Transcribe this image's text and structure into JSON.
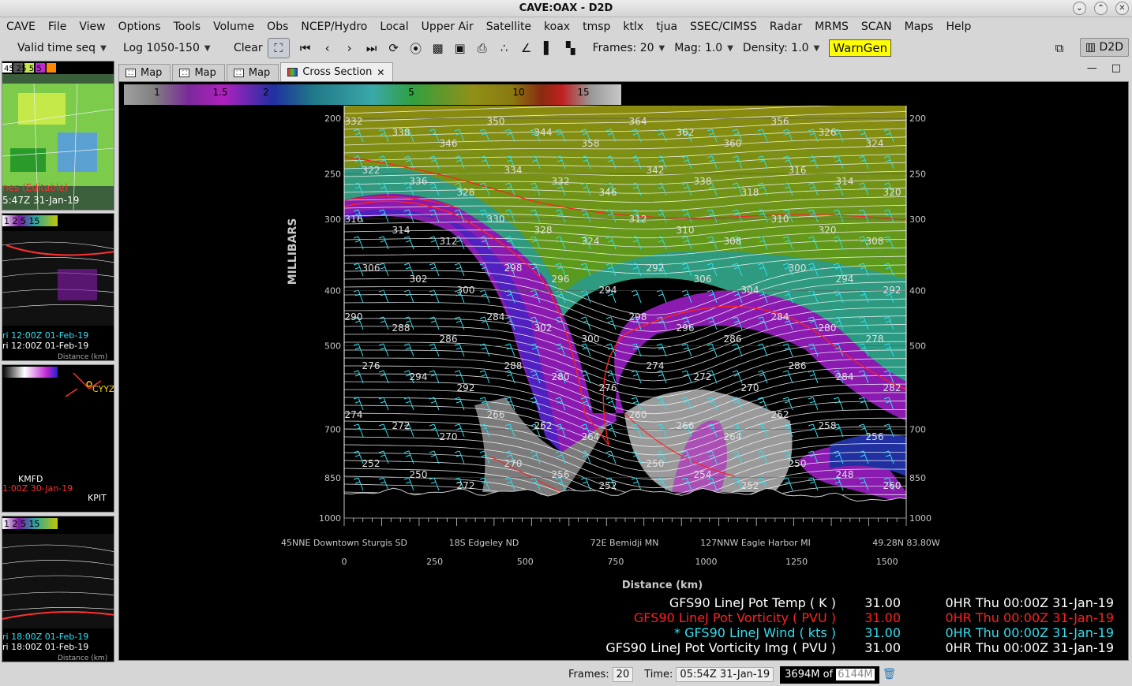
{
  "window": {
    "title": "CAVE:OAX - D2D",
    "buttons": [
      "⌄",
      "⌃",
      "✕"
    ]
  },
  "menu": [
    "CAVE",
    "File",
    "View",
    "Options",
    "Tools",
    "Volume",
    "Obs",
    "NCEP/Hydro",
    "Local",
    "Upper Air",
    "Satellite",
    "koax",
    "tmsp",
    "ktlx",
    "tjua",
    "SSEC/CIMSS",
    "Radar",
    "MRMS",
    "SCAN",
    "Maps",
    "Help"
  ],
  "toolbar": {
    "time_seq": "Valid time seq",
    "log": "Log 1050-150",
    "clear": "Clear",
    "frames": "Frames: 20",
    "mag": "Mag: 1.0",
    "density": "Density: 1.0",
    "warngen": "WarnGen",
    "d2d": "D2D"
  },
  "tabs": [
    {
      "label": "Map",
      "active": false
    },
    {
      "label": "Map",
      "active": false
    },
    {
      "label": "Map",
      "active": false
    },
    {
      "label": "Cross Section",
      "active": true
    }
  ],
  "side_panes": [
    {
      "top_text": "45 25 5 5",
      "label1": "nes (Editable)",
      "label2": "5:47Z 31-Jan-19"
    },
    {
      "scale": "1 2 5 15",
      "label1": "ri 12:00Z 01-Feb-19",
      "label2": "ri 12:00Z 01-Feb-19",
      "label3": "Distance (km)"
    },
    {
      "station": "CYYZ",
      "label1": "1:00Z 30-Jan-19",
      "label2": "KMFD",
      "label3": "KPIT"
    },
    {
      "scale": "1 2 5 15",
      "label1": "ri 18:00Z 01-Feb-19",
      "label2": "ri 18:00Z 01-Feb-19",
      "label3": "Distance (km)"
    }
  ],
  "colorbar": {
    "ticks": [
      "1",
      "1.5",
      "2",
      "5",
      "10",
      "15"
    ]
  },
  "axes": {
    "ylabel": "MILLIBARS",
    "pressure_ticks": [
      "200",
      "250",
      "300",
      "400",
      "500",
      "700",
      "850",
      "1000"
    ],
    "xlabel": "Distance (km)",
    "distance_ticks": [
      "0",
      "250",
      "500",
      "750",
      "1000",
      "1250",
      "1500"
    ],
    "locations": [
      "45NNE Downtown Sturgis SD",
      "18S Edgeley ND",
      "72E Bemidji MN",
      "127NNW Eagle Harbor MI",
      "49.28N 83.80W"
    ]
  },
  "theta_labels": [
    "332",
    "338",
    "346",
    "350",
    "344",
    "358",
    "364",
    "362",
    "360",
    "356",
    "326",
    "324",
    "322",
    "336",
    "328",
    "334",
    "332",
    "346",
    "342",
    "338",
    "318",
    "316",
    "314",
    "320",
    "316",
    "314",
    "312",
    "330",
    "328",
    "324",
    "312",
    "310",
    "308",
    "310",
    "320",
    "308",
    "306",
    "302",
    "300",
    "298",
    "296",
    "294",
    "292",
    "306",
    "304",
    "300",
    "294",
    "292",
    "290",
    "288",
    "286",
    "284",
    "302",
    "300",
    "298",
    "296",
    "286",
    "284",
    "280",
    "278",
    "276",
    "294",
    "292",
    "288",
    "280",
    "276",
    "274",
    "272",
    "270",
    "286",
    "284",
    "282",
    "274",
    "272",
    "270",
    "266",
    "262",
    "264",
    "260",
    "266",
    "264",
    "262",
    "258",
    "256",
    "252",
    "250",
    "272",
    "270",
    "256",
    "252",
    "250",
    "254",
    "252",
    "250",
    "248",
    "260"
  ],
  "legend": [
    {
      "text": "GFS90 LineJ Pot Temp ( K )",
      "value": "31.00",
      "time": "0HR Thu 00:00Z 31-Jan-19",
      "color": "#ffffff"
    },
    {
      "text": "GFS90 LineJ Pot Vorticity ( PVU )",
      "value": "31.00",
      "time": "0HR Thu 00:00Z 31-Jan-19",
      "color": "#ff2020"
    },
    {
      "text": "* GFS90 LineJ Wind ( kts )",
      "value": "31.00",
      "time": "0HR Thu 00:00Z 31-Jan-19",
      "color": "#30e0f0"
    },
    {
      "text": "GFS90 LineJ Pot Vorticity Img ( PVU )",
      "value": "31.00",
      "time": "0HR Thu 00:00Z 31-Jan-19",
      "color": "#ffffff"
    }
  ],
  "status": {
    "frames_label": "Frames:",
    "frames_value": "20",
    "time_label": "Time:",
    "time_value": "05:54Z 31-Jan-19",
    "memory_used": "3694M of ",
    "memory_total": "6144M"
  }
}
